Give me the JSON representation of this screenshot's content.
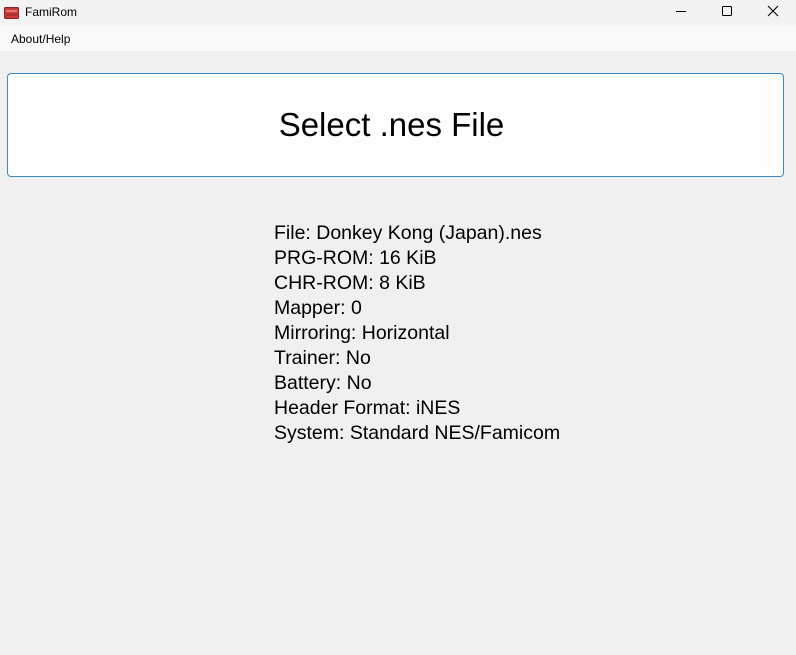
{
  "window": {
    "title": "FamiRom",
    "icon": "nes-cartridge-icon",
    "icon_color": "#c73b3b",
    "controls": [
      "minimize-icon",
      "maximize-icon",
      "close-icon"
    ]
  },
  "menu": {
    "items": [
      {
        "label": "About/Help"
      }
    ]
  },
  "main": {
    "select_button_label": "Select .nes File",
    "accent_border_color": "#3b8ac4",
    "info_lines": [
      "File: Donkey Kong (Japan).nes",
      "PRG-ROM: 16 KiB",
      "CHR-ROM: 8 KiB",
      "Mapper: 0",
      "Mirroring: Horizontal",
      "Trainer: No",
      "Battery: No",
      "Header Format: iNES",
      "System: Standard NES/Famicom"
    ]
  }
}
